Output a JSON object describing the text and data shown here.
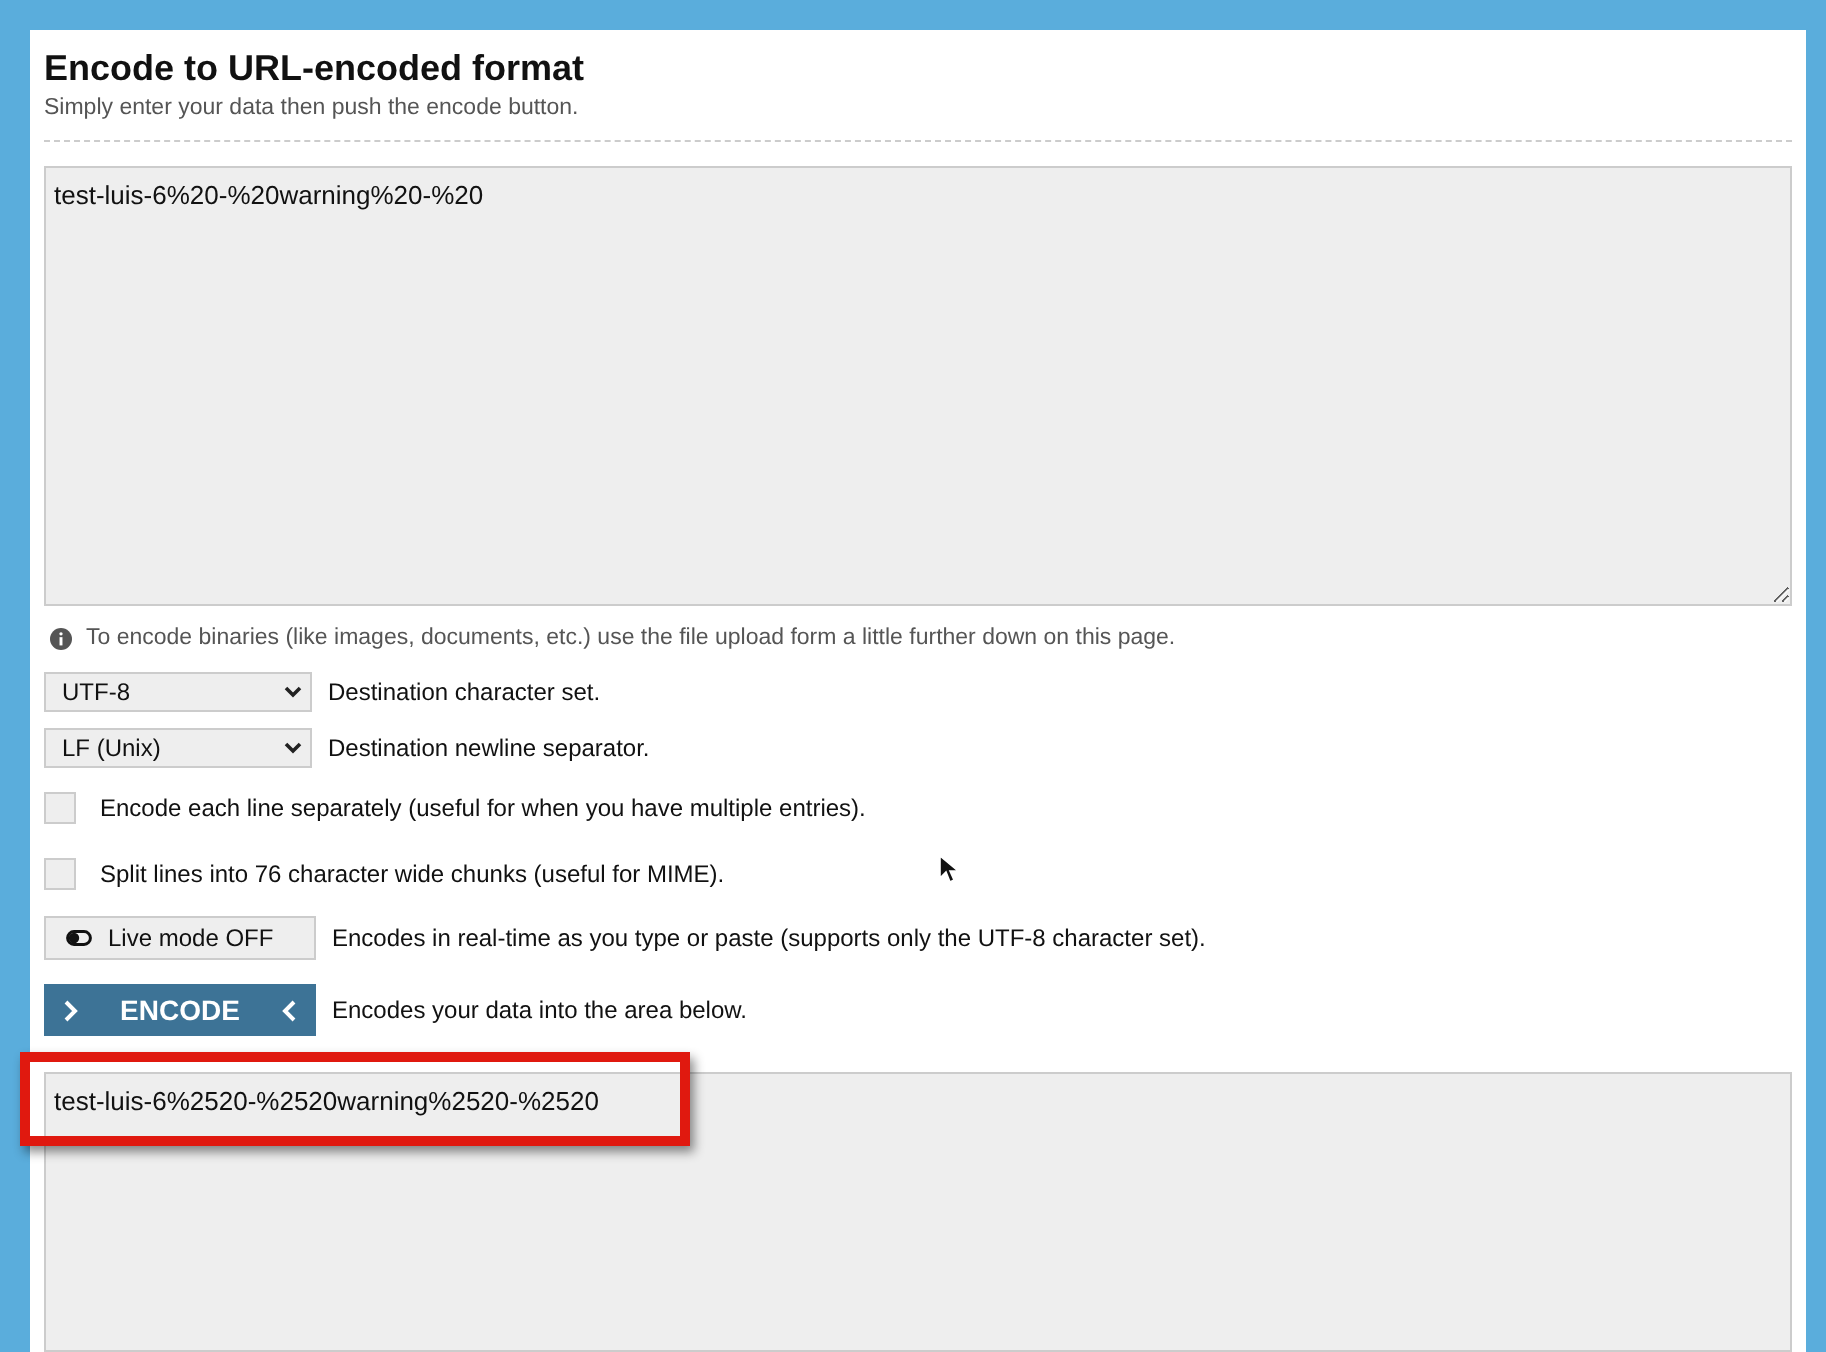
{
  "header": {
    "title": "Encode to URL-encoded format",
    "subtitle": "Simply enter your data then push the encode button."
  },
  "input": {
    "value": "test-luis-6%20-%20warning%20-%20"
  },
  "info": "To encode binaries (like images, documents, etc.) use the file upload form a little further down on this page.",
  "selects": [
    {
      "value": "UTF-8",
      "label": "Destination character set."
    },
    {
      "value": "LF (Unix)",
      "label": "Destination newline separator."
    }
  ],
  "checkboxes": [
    {
      "label": "Encode each line separately (useful for when you have multiple entries).",
      "checked": false
    },
    {
      "label": "Split lines into 76 character wide chunks (useful for MIME).",
      "checked": false
    }
  ],
  "live_mode": {
    "label": "Live mode OFF",
    "on": false,
    "description": "Encodes in real-time as you type or paste (supports only the UTF-8 character set)."
  },
  "encode": {
    "label": "ENCODE",
    "description": "Encodes your data into the area below."
  },
  "output": {
    "value": "test-luis-6%2520-%2520warning%2520-%2520",
    "highlighted": true
  }
}
